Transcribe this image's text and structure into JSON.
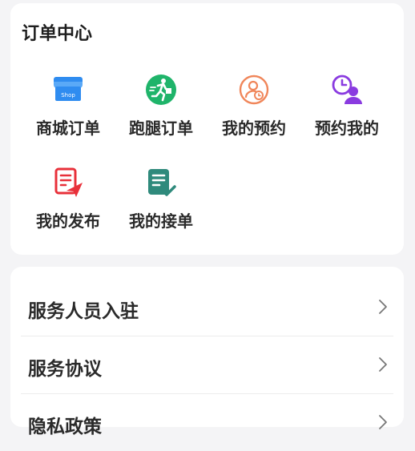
{
  "order_center": {
    "title": "订单中心",
    "items": [
      {
        "label": "商城订单",
        "icon": "shop-icon"
      },
      {
        "label": "跑腿订单",
        "icon": "courier-run-icon"
      },
      {
        "label": "我的预约",
        "icon": "user-clock-icon"
      },
      {
        "label": "预约我的",
        "icon": "clock-user-icon"
      },
      {
        "label": "我的发布",
        "icon": "document-send-icon"
      },
      {
        "label": "我的接单",
        "icon": "document-check-icon"
      }
    ],
    "shop_badge": "Shop"
  },
  "menu": {
    "items": [
      {
        "label": "服务人员入驻",
        "icon": "chevron-right-icon"
      },
      {
        "label": "服务协议",
        "icon": "chevron-right-icon"
      },
      {
        "label": "隐私政策",
        "icon": "chevron-right-icon"
      }
    ]
  },
  "colors": {
    "background": "#f4f4f6",
    "card": "#ffffff",
    "shop_blue": "#2f8cf0",
    "courier_green": "#1fb46a",
    "orange": "#f0865a",
    "purple": "#8a3be0",
    "red": "#e8303a",
    "teal": "#2f8a7c"
  }
}
